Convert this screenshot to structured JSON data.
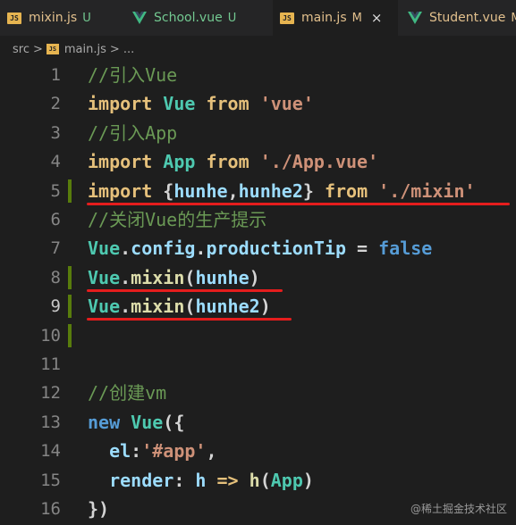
{
  "tabs": [
    {
      "icon": "js",
      "name": "mixin.js",
      "status": "U"
    },
    {
      "icon": "vue",
      "name": "School.vue",
      "status": "U"
    },
    {
      "icon": "js",
      "name": "main.js",
      "status": "M",
      "close": "×"
    },
    {
      "icon": "vue",
      "name": "Student.vue",
      "status": "M"
    }
  ],
  "breadcrumb": {
    "folder": "src",
    "sep": ">",
    "file": "main.js",
    "more": "> ..."
  },
  "lines": [
    {
      "n": "1",
      "tokens": [
        [
          "//引入Vue",
          "com"
        ]
      ]
    },
    {
      "n": "2",
      "tokens": [
        [
          "import ",
          "imp"
        ],
        [
          "Vue ",
          "id"
        ],
        [
          "from ",
          "imp"
        ],
        [
          "'vue'",
          "str"
        ]
      ]
    },
    {
      "n": "3",
      "tokens": [
        [
          "//引入App",
          "com"
        ]
      ]
    },
    {
      "n": "4",
      "tokens": [
        [
          "import ",
          "imp"
        ],
        [
          "App ",
          "id"
        ],
        [
          "from ",
          "imp"
        ],
        [
          "'./App.vue'",
          "str"
        ]
      ]
    },
    {
      "n": "5",
      "tokens": [
        [
          "import ",
          "imp"
        ],
        [
          "{",
          "op"
        ],
        [
          "hunhe",
          "var"
        ],
        [
          ",",
          "op"
        ],
        [
          "hunhe2",
          "var"
        ],
        [
          "} ",
          "op"
        ],
        [
          "from ",
          "imp"
        ],
        [
          "'./mixin'",
          "str"
        ]
      ]
    },
    {
      "n": "6",
      "tokens": [
        [
          "//关闭Vue的生产提示",
          "com"
        ]
      ]
    },
    {
      "n": "7",
      "tokens": [
        [
          "Vue",
          "id"
        ],
        [
          ".",
          "op"
        ],
        [
          "config",
          "var"
        ],
        [
          ".",
          "op"
        ],
        [
          "productionTip",
          "var"
        ],
        [
          " = ",
          "op"
        ],
        [
          "false",
          "bool"
        ]
      ]
    },
    {
      "n": "8",
      "tokens": [
        [
          "Vue",
          "id"
        ],
        [
          ".",
          "op"
        ],
        [
          "mixin",
          "fn"
        ],
        [
          "(",
          "op"
        ],
        [
          "hunhe",
          "var"
        ],
        [
          ")",
          "op"
        ]
      ]
    },
    {
      "n": "9",
      "tokens": [
        [
          "Vue",
          "id"
        ],
        [
          ".",
          "op"
        ],
        [
          "mixin",
          "fn"
        ],
        [
          "(",
          "op"
        ],
        [
          "hunhe2",
          "var"
        ],
        [
          ")",
          "op"
        ]
      ]
    },
    {
      "n": "10",
      "tokens": []
    },
    {
      "n": "11",
      "tokens": []
    },
    {
      "n": "12",
      "tokens": [
        [
          "//创建vm",
          "com"
        ]
      ]
    },
    {
      "n": "13",
      "tokens": [
        [
          "new ",
          "new"
        ],
        [
          "Vue",
          "id"
        ],
        [
          "({",
          "op"
        ]
      ]
    },
    {
      "n": "14",
      "tokens": [
        [
          "  el",
          "var"
        ],
        [
          ":",
          "op"
        ],
        [
          "'#app'",
          "str"
        ],
        [
          ",",
          "op"
        ]
      ]
    },
    {
      "n": "15",
      "tokens": [
        [
          "  render",
          "var"
        ],
        [
          ": ",
          "op"
        ],
        [
          "h ",
          "var"
        ],
        [
          "=> ",
          "imp"
        ],
        [
          "h",
          "fn"
        ],
        [
          "(",
          "op"
        ],
        [
          "App",
          "id"
        ],
        [
          ")",
          "op"
        ]
      ]
    },
    {
      "n": "16",
      "tokens": [
        [
          "})",
          "op"
        ]
      ]
    }
  ],
  "watermark": "@稀土掘金技术社区",
  "colors": {
    "underline": "#e51d1d",
    "modified_gutter": "#587c0c"
  }
}
